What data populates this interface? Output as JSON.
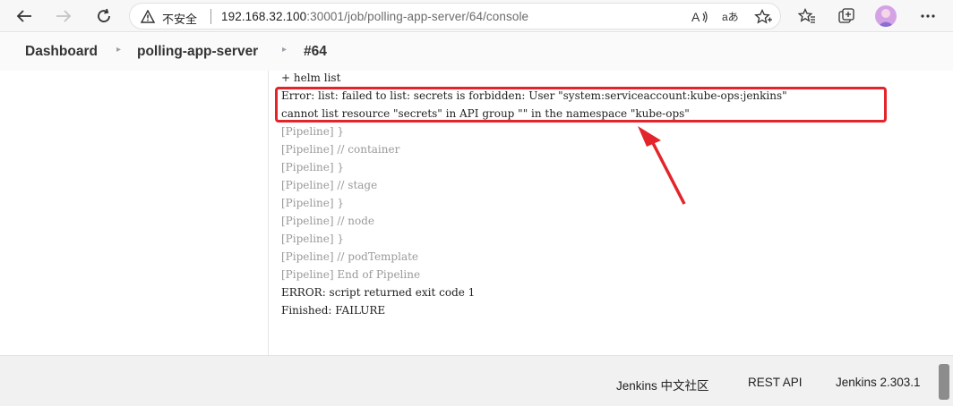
{
  "browser": {
    "security_label": "不安全",
    "url_host": "192.168.32.100",
    "url_path": ":30001/job/polling-app-server/64/console"
  },
  "breadcrumb": {
    "items": [
      "Dashboard",
      "polling-app-server",
      "#64"
    ]
  },
  "console": {
    "lines": [
      "+ helm list",
      "Error: list: failed to list: secrets is forbidden: User \"system:serviceaccount:kube-ops:jenkins\"",
      "cannot list resource \"secrets\" in API group \"\" in the namespace \"kube-ops\"",
      "[Pipeline] }",
      "[Pipeline] // container",
      "[Pipeline] }",
      "[Pipeline] // stage",
      "[Pipeline] }",
      "[Pipeline] // node",
      "[Pipeline] }",
      "[Pipeline] // podTemplate",
      "[Pipeline] End of Pipeline",
      "ERROR: script returned exit code 1",
      "Finished: FAILURE"
    ]
  },
  "footer": {
    "community": "Jenkins 中文社区",
    "rest_api": "REST API",
    "version": "Jenkins 2.303.1"
  },
  "colors": {
    "highlight": "#e3242b"
  }
}
